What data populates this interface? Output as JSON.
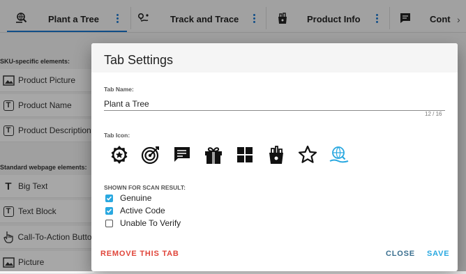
{
  "tabs": [
    {
      "label": "Plant a Tree",
      "icon": "hand-globe-search-icon",
      "active": true
    },
    {
      "label": "Track and Trace",
      "icon": "route-pin-icon",
      "active": false
    },
    {
      "label": "Product Info",
      "icon": "grocery-bag-icon",
      "active": false
    },
    {
      "label": "Cont",
      "icon": "chat-bubble-icon",
      "active": false
    }
  ],
  "sidebar": {
    "sku_title": "SKU-specific elements:",
    "sku_items": [
      {
        "label": "Product Picture",
        "icon": "image-icon"
      },
      {
        "label": "Product Name",
        "icon": "text-box-icon"
      },
      {
        "label": "Product Description",
        "icon": "text-box-icon"
      }
    ],
    "std_title": "Standard webpage elements:",
    "std_items": [
      {
        "label": "Big Text",
        "icon": "text-t-icon"
      },
      {
        "label": "Text Block",
        "icon": "text-box-icon"
      },
      {
        "label": "Call-To-Action Button",
        "icon": "hand-pointer-icon"
      },
      {
        "label": "Picture",
        "icon": "image-icon"
      }
    ]
  },
  "dialog": {
    "title": "Tab Settings",
    "name_label": "Tab Name:",
    "name_value": "Plant a Tree",
    "counter": "12 / 16",
    "icon_label": "Tab Icon:",
    "icons": [
      {
        "name": "badge-star-icon",
        "selected": false
      },
      {
        "name": "target-icon",
        "selected": false
      },
      {
        "name": "chat-bubble-icon",
        "selected": false
      },
      {
        "name": "gift-icon",
        "selected": false
      },
      {
        "name": "grid-icon",
        "selected": false
      },
      {
        "name": "grocery-bag-icon",
        "selected": false
      },
      {
        "name": "star-outline-icon",
        "selected": false
      },
      {
        "name": "hand-globe-search-icon",
        "selected": true
      }
    ],
    "scan_label": "SHOWN FOR SCAN RESULT:",
    "scan_options": [
      {
        "label": "Genuine",
        "checked": true
      },
      {
        "label": "Active Code",
        "checked": true
      },
      {
        "label": "Unable To Verify",
        "checked": false
      }
    ],
    "remove_label": "REMOVE THIS TAB",
    "close_label": "CLOSE",
    "save_label": "SAVE"
  },
  "colors": {
    "accent": "#1a73c9",
    "danger": "#e0453a",
    "save": "#29a8e0",
    "checkbox": "#29a8e0"
  }
}
